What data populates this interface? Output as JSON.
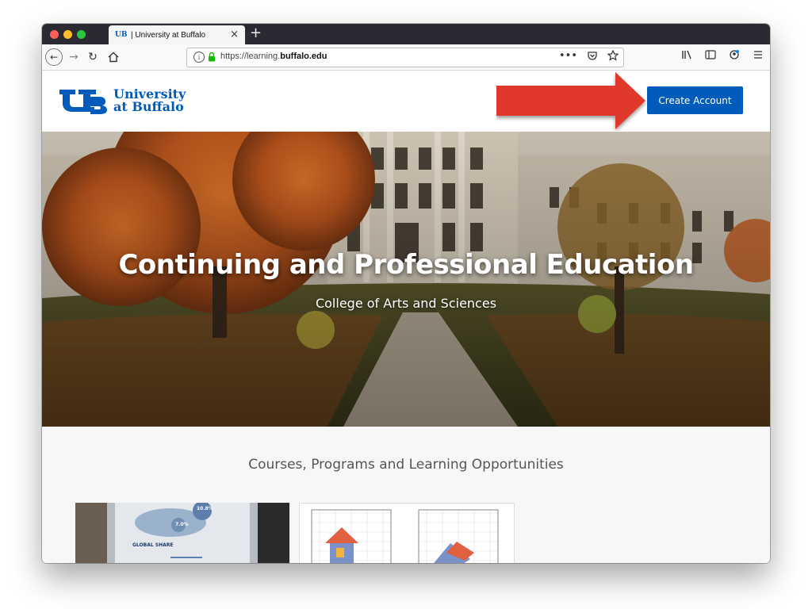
{
  "browser": {
    "tab_title": "| University at Buffalo",
    "tab_favicon": "UB",
    "new_tab": "+",
    "close_tab": "×",
    "url_prefix": "https://learning.",
    "url_domain": "buffalo.edu",
    "url_actions": [
      "•••",
      "pocket-icon",
      "star-icon"
    ],
    "toolbar_icons": [
      "library-icon",
      "sidebar-icon",
      "account-icon",
      "menu-icon"
    ]
  },
  "site": {
    "logo_line1": "University",
    "logo_line2": "at Buffalo",
    "create_account": "Create Account",
    "hero_title": "Continuing and Professional Education",
    "hero_subtitle": "College of Arts and Sciences",
    "courses_heading": "Courses, Programs and Learning Opportunities",
    "card1_label": "GLOBAL SHARE",
    "card1_badge1": "10.8%",
    "card1_badge2": "7.0%"
  },
  "colors": {
    "brand_blue": "#005bbb",
    "arrow_red": "#e0392a"
  }
}
